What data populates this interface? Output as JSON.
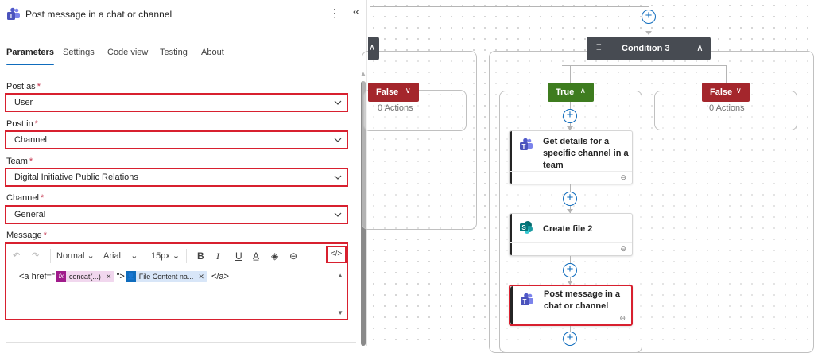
{
  "panel": {
    "title": "Post message in a chat or channel",
    "more_label": "⋮",
    "collapse_label": "«",
    "tabs": [
      {
        "label": "Parameters",
        "active": true
      },
      {
        "label": "Settings"
      },
      {
        "label": "Code view"
      },
      {
        "label": "Testing"
      },
      {
        "label": "About"
      }
    ],
    "fields": {
      "post_as": {
        "label": "Post as",
        "required": "*",
        "value": "User"
      },
      "post_in": {
        "label": "Post in",
        "required": "*",
        "value": "Channel"
      },
      "team": {
        "label": "Team",
        "required": "*",
        "value": "Digital Initiative Public Relations"
      },
      "channel": {
        "label": "Channel",
        "required": "*",
        "value": "General"
      },
      "message": {
        "label": "Message",
        "required": "*"
      }
    },
    "toolbar": {
      "undo": "↶",
      "redo": "↷",
      "style": "Normal",
      "font": "Arial",
      "size": "15px",
      "bold": "B",
      "italic": "I",
      "underline": "U",
      "font_color": "A̲",
      "highlight": "◈",
      "link": "⊖",
      "code_view": "</>"
    },
    "editor": {
      "prefix": "<a href=\"",
      "token1": {
        "icon": "fx",
        "label": "concat(...)"
      },
      "middle": "\">",
      "token2": {
        "icon": "👤",
        "label": "File Content na..."
      },
      "suffix": "</a>",
      "remove": "✕"
    }
  },
  "canvas": {
    "condition": {
      "icon": "⌶",
      "title": "Condition 3",
      "chevron": "∧"
    },
    "left_branch": {
      "label": "False",
      "chevron": "∨",
      "actions": "0 Actions",
      "collapse": "∧"
    },
    "true_branch": {
      "label": "True",
      "chevron": "∧"
    },
    "false_branch": {
      "label": "False",
      "chevron": "∨",
      "actions": "0 Actions"
    },
    "cards": [
      {
        "title": "Get details for a specific channel in a team",
        "icon": "teams-icon"
      },
      {
        "title": "Create file 2",
        "icon": "sharepoint-icon"
      },
      {
        "title": "Post message in a chat or channel",
        "icon": "teams-icon",
        "selected": true
      }
    ],
    "plus": "+",
    "link_glyph": "⊖",
    "grip": "⋮"
  },
  "colors": {
    "highlight_border": "#d8202f",
    "true_branch": "#3e7c1f",
    "false_branch": "#a4262c",
    "condition_header": "#474b52",
    "accent": "#0f6cbd"
  }
}
